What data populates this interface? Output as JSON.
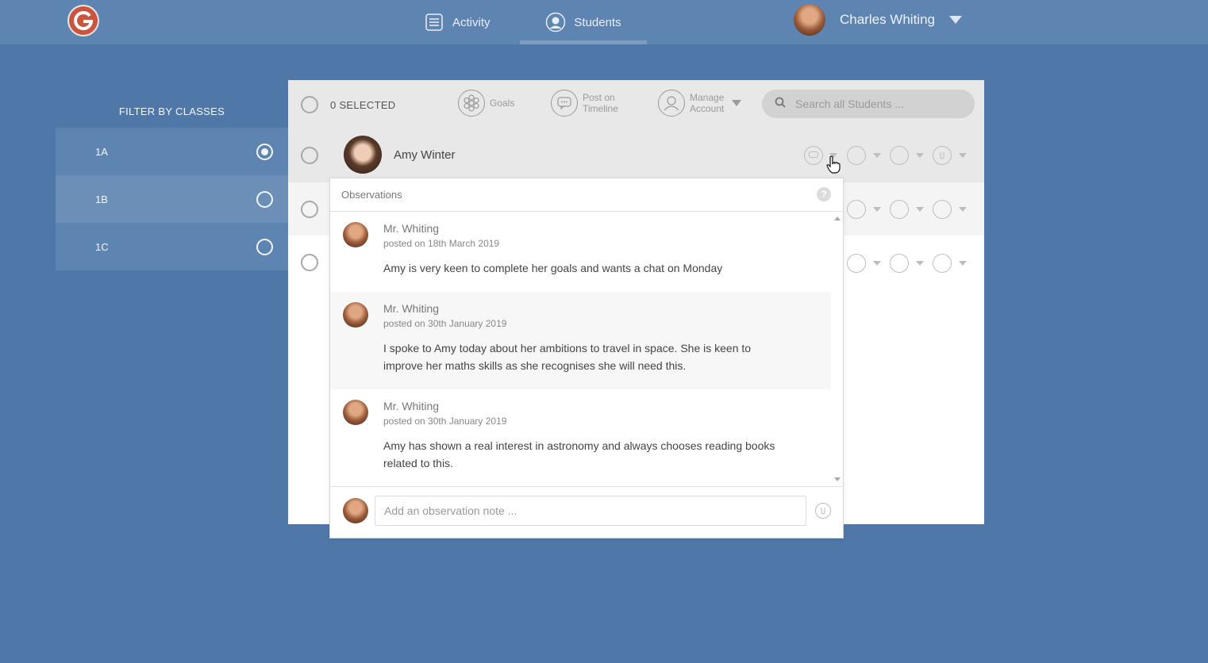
{
  "header": {
    "logo_letter": "G",
    "nav": [
      {
        "label": "Activity",
        "icon": "list-icon"
      },
      {
        "label": "Students",
        "icon": "user-circle-icon",
        "active": true
      }
    ],
    "user": {
      "name": "Charles Whiting"
    }
  },
  "sidebar": {
    "title": "FILTER BY CLASSES",
    "classes": [
      {
        "label": "1A",
        "selected": true
      },
      {
        "label": "1B",
        "selected": false
      },
      {
        "label": "1C",
        "selected": false
      }
    ]
  },
  "toolbar": {
    "selected_label": "0 SELECTED",
    "goals_label": "Goals",
    "post_label_1": "Post on",
    "post_label_2": "Timeline",
    "manage_label_1": "Manage",
    "manage_label_2": "Account",
    "search_placeholder": "Search all Students ..."
  },
  "students": [
    {
      "name": "Amy Winter"
    }
  ],
  "observations": {
    "title": "Observations",
    "help": "?",
    "items": [
      {
        "author": "Mr. Whiting",
        "date": "posted on 18th March 2019",
        "text": "Amy is very keen to complete her goals and wants a chat on Monday"
      },
      {
        "author": "Mr. Whiting",
        "date": "posted on 30th January 2019",
        "text": "I spoke to Amy today about her ambitions to travel in space. She is keen to improve her maths skills as she recognises she will need this."
      },
      {
        "author": "Mr. Whiting",
        "date": "posted on 30th January 2019",
        "text": "Amy has shown a real interest in astronomy and always chooses reading books related to this."
      }
    ],
    "input_placeholder": "Add an observation note ..."
  },
  "colors": {
    "background": "#4f78a8",
    "topbar": "#5e85b1",
    "logo": "#c9553f"
  }
}
